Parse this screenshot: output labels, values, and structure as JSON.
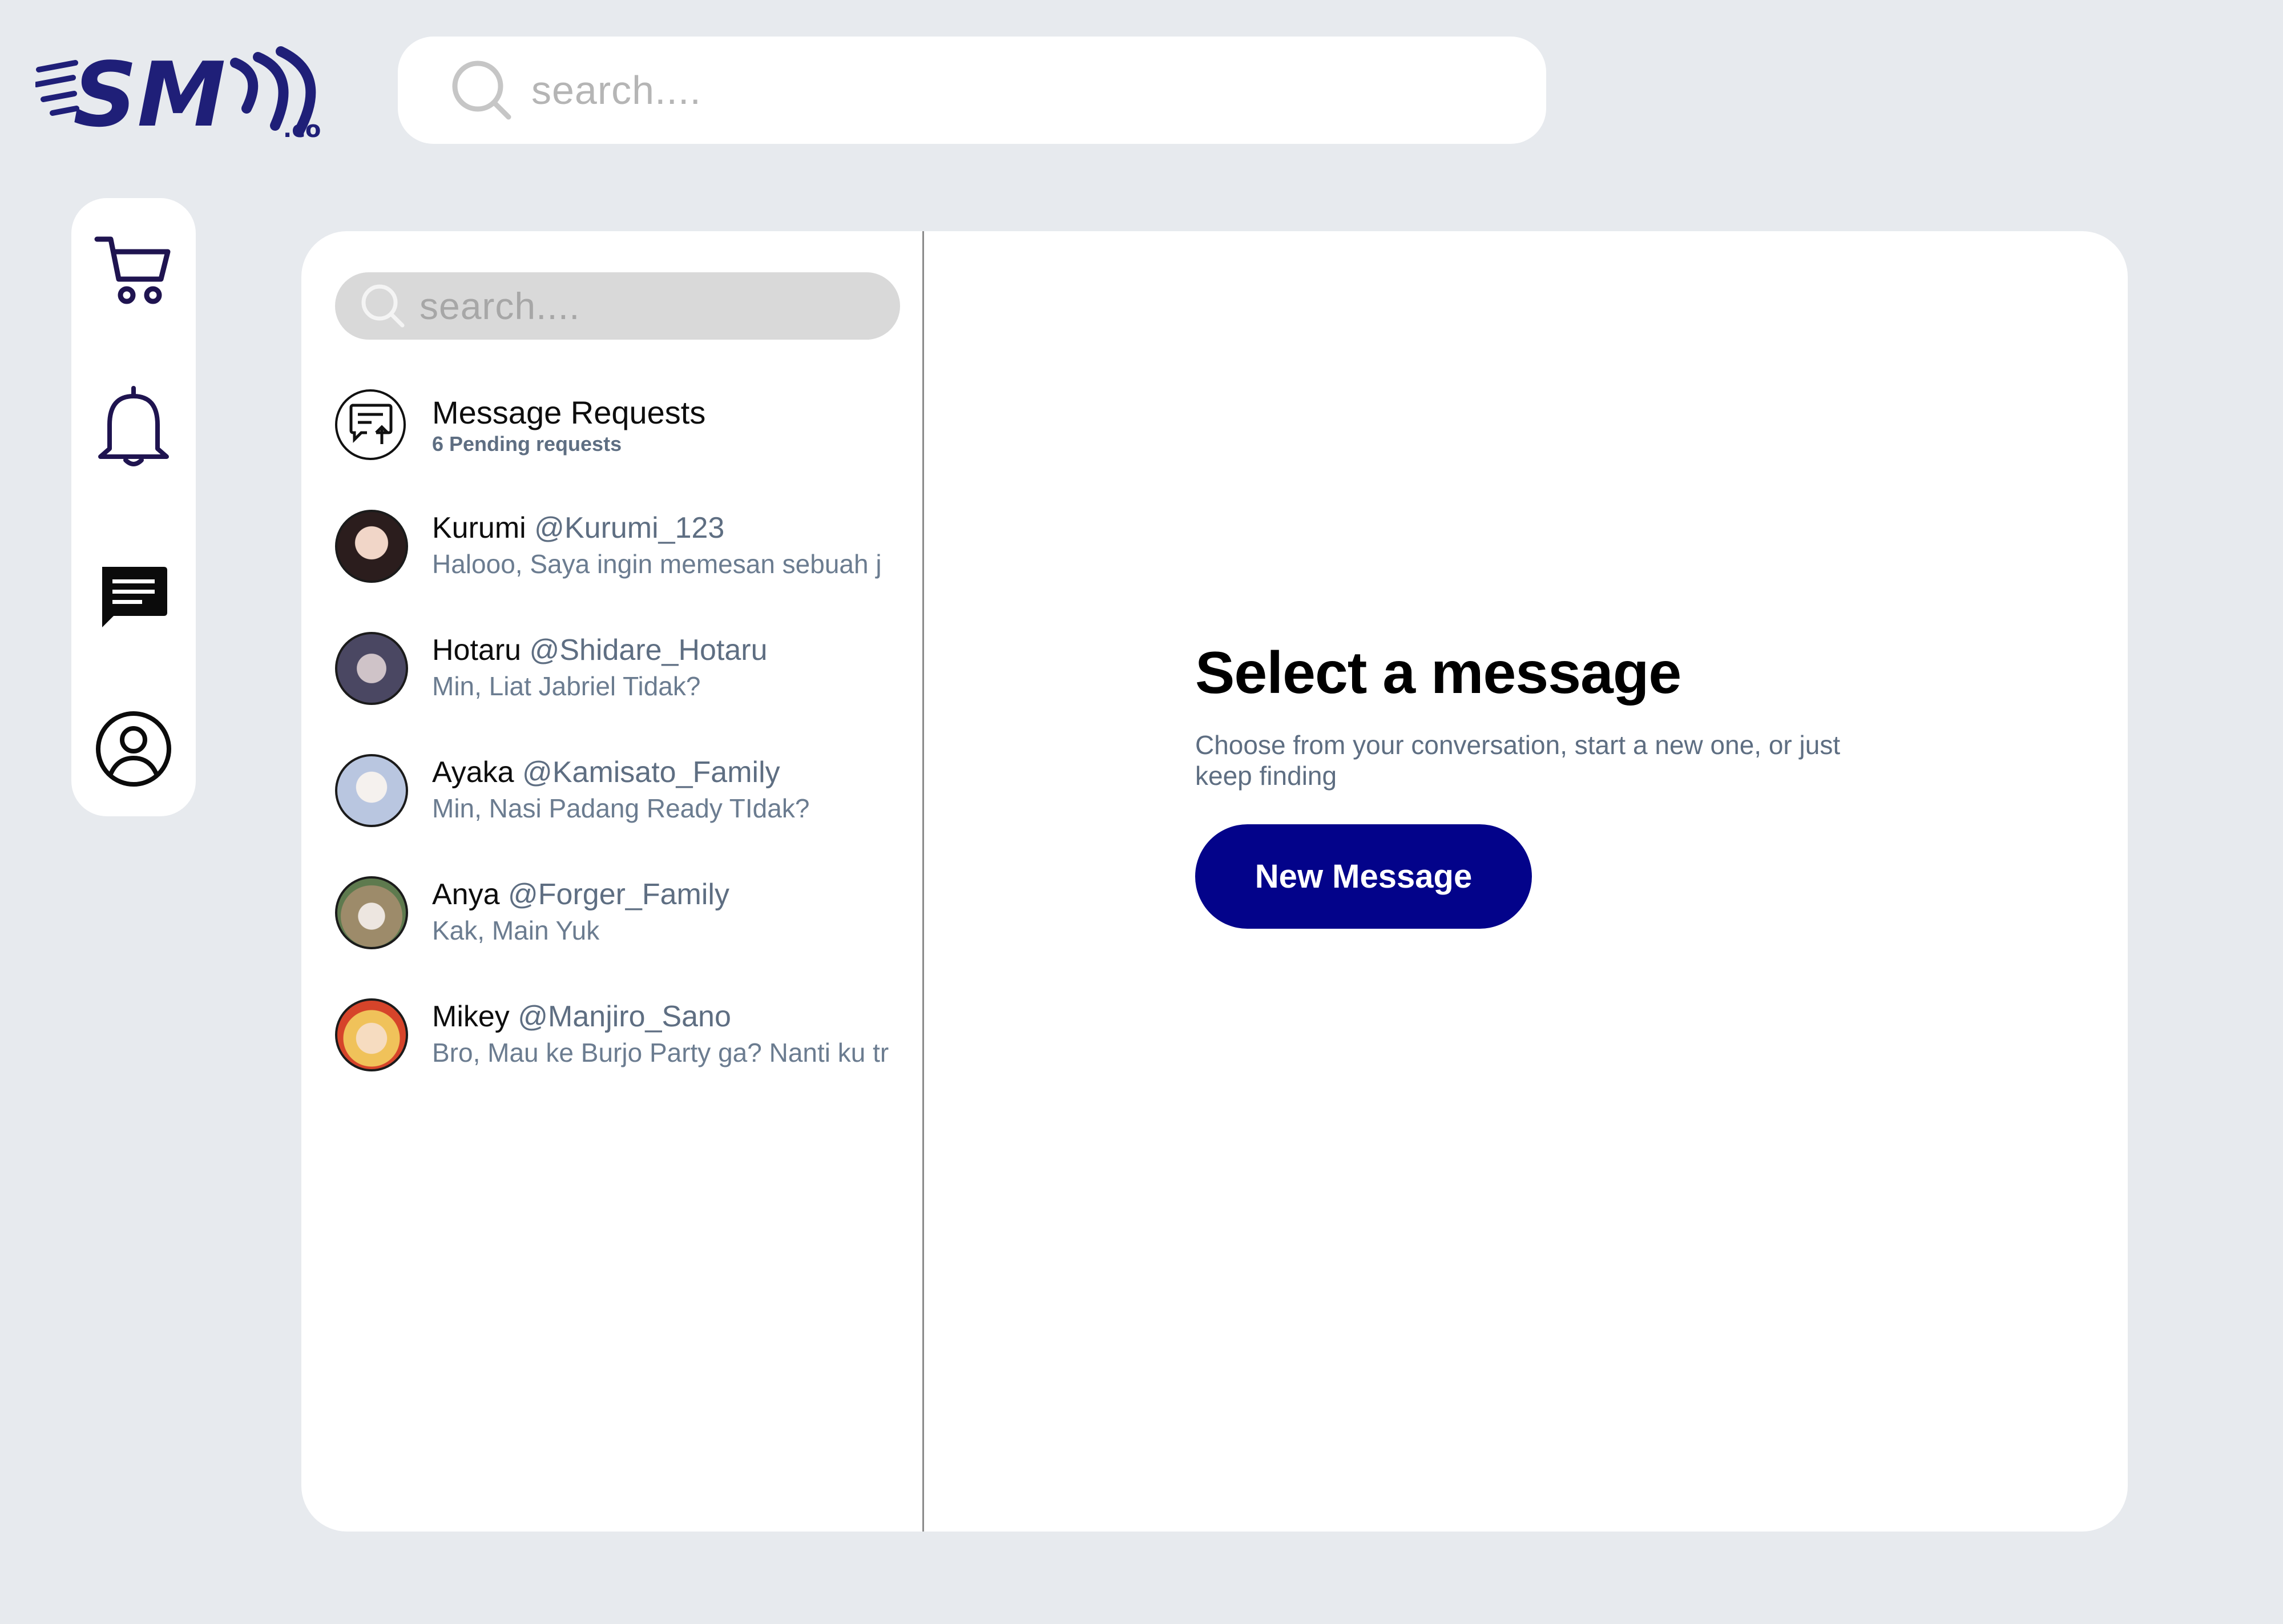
{
  "logo": {
    "text": "SM",
    "suffix": ".co",
    "brand_color": "#1f1f78"
  },
  "header": {
    "search_placeholder": "search....",
    "search_icon": "search-icon"
  },
  "sidebar": {
    "items": [
      {
        "name": "cart",
        "icon": "cart-icon"
      },
      {
        "name": "notifications",
        "icon": "bell-icon"
      },
      {
        "name": "messages",
        "icon": "chat-icon",
        "active": true
      },
      {
        "name": "profile",
        "icon": "user-icon"
      }
    ]
  },
  "messages_panel": {
    "search_placeholder": "search....",
    "requests": {
      "title": "Message Requests",
      "subtitle": "6 Pending requests"
    },
    "conversations": [
      {
        "name": "Kurumi",
        "handle": "@Kurumi_123",
        "preview": "Halooo, Saya ingin memesan sebuah j",
        "avatar_color": "#3b2a2a"
      },
      {
        "name": "Hotaru",
        "handle": "@Shidare_Hotaru",
        "preview": "Min, Liat Jabriel Tidak?",
        "avatar_color": "#4a4a6a"
      },
      {
        "name": "Ayaka",
        "handle": "@Kamisato_Family",
        "preview": "Min, Nasi Padang Ready TIdak?",
        "avatar_color": "#c9d3e6"
      },
      {
        "name": "Anya",
        "handle": "@Forger_Family",
        "preview": "Kak, Main Yuk",
        "avatar_color": "#b8a07a"
      },
      {
        "name": "Mikey",
        "handle": "@Manjiro_Sano",
        "preview": "Bro, Mau ke Burjo Party ga? Nanti ku tr",
        "avatar_color": "#d6442a"
      }
    ]
  },
  "empty_state": {
    "title": "Select a message",
    "description": "Choose from your conversation, start a new one, or just keep finding",
    "button_label": "New Message",
    "button_color": "#03038a"
  },
  "colors": {
    "background": "#e7eaee",
    "muted_text": "#5e6e82",
    "accent": "#03038a"
  }
}
